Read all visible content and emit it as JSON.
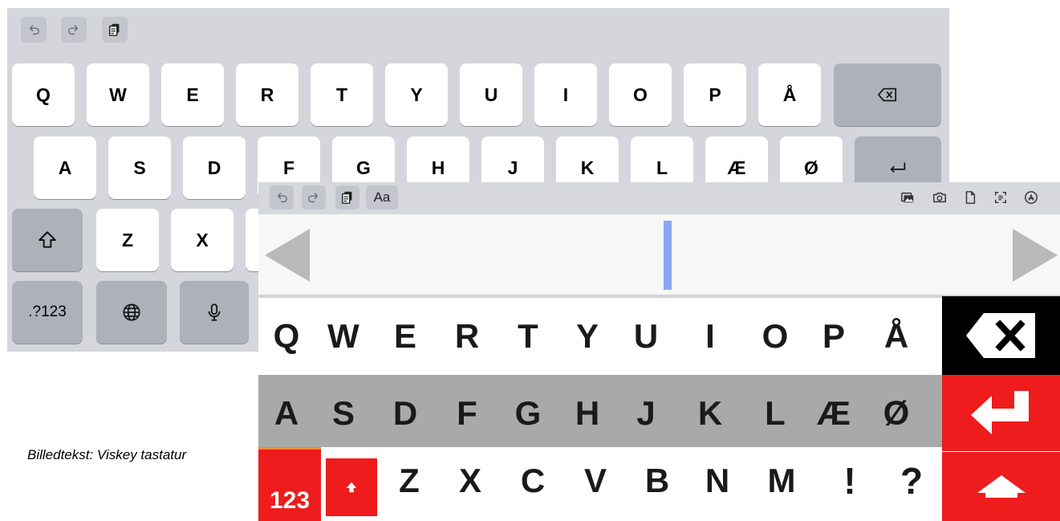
{
  "ios_keyboard": {
    "toolbar": {
      "undo_icon": "undo-icon",
      "redo_icon": "redo-icon",
      "paste_icon": "paste-icon"
    },
    "row1": [
      "Q",
      "W",
      "E",
      "R",
      "T",
      "Y",
      "U",
      "I",
      "O",
      "P",
      "Å"
    ],
    "row2": [
      "A",
      "S",
      "D",
      "F",
      "G",
      "H",
      "J",
      "K",
      "L",
      "Æ",
      "Ø"
    ],
    "row3": [
      "Z",
      "X"
    ],
    "numbers_label": ".?123",
    "icons": {
      "delete": "delete-icon",
      "return": "return-icon",
      "shift": "shift-icon",
      "globe": "globe-icon",
      "mic": "microphone-icon"
    }
  },
  "viskey": {
    "toolbar": {
      "left_icons": [
        "undo-icon",
        "redo-icon",
        "paste-icon"
      ],
      "text_size_label": "Aa",
      "right_icons": [
        "photo-library-icon",
        "camera-icon",
        "document-icon",
        "scan-text-icon",
        "app-store-icon"
      ]
    },
    "row1": [
      "Q",
      "W",
      "E",
      "R",
      "T",
      "Y",
      "U",
      "I",
      "O",
      "P",
      "Å"
    ],
    "row2": [
      "A",
      "S",
      "D",
      "F",
      "G",
      "H",
      "J",
      "K",
      "L",
      "Æ",
      "Ø"
    ],
    "row3": [
      "Z",
      "X",
      "C",
      "V",
      "B",
      "N",
      "M",
      "!",
      "?"
    ],
    "numbers_label": "123",
    "colors": {
      "accent_red": "#ee1c1c",
      "row_gray": "#a9a9a9",
      "cursor_blue": "#8aa6ef",
      "delete_bg": "#000000"
    }
  },
  "caption": "Billedtekst: Viskey tastatur"
}
